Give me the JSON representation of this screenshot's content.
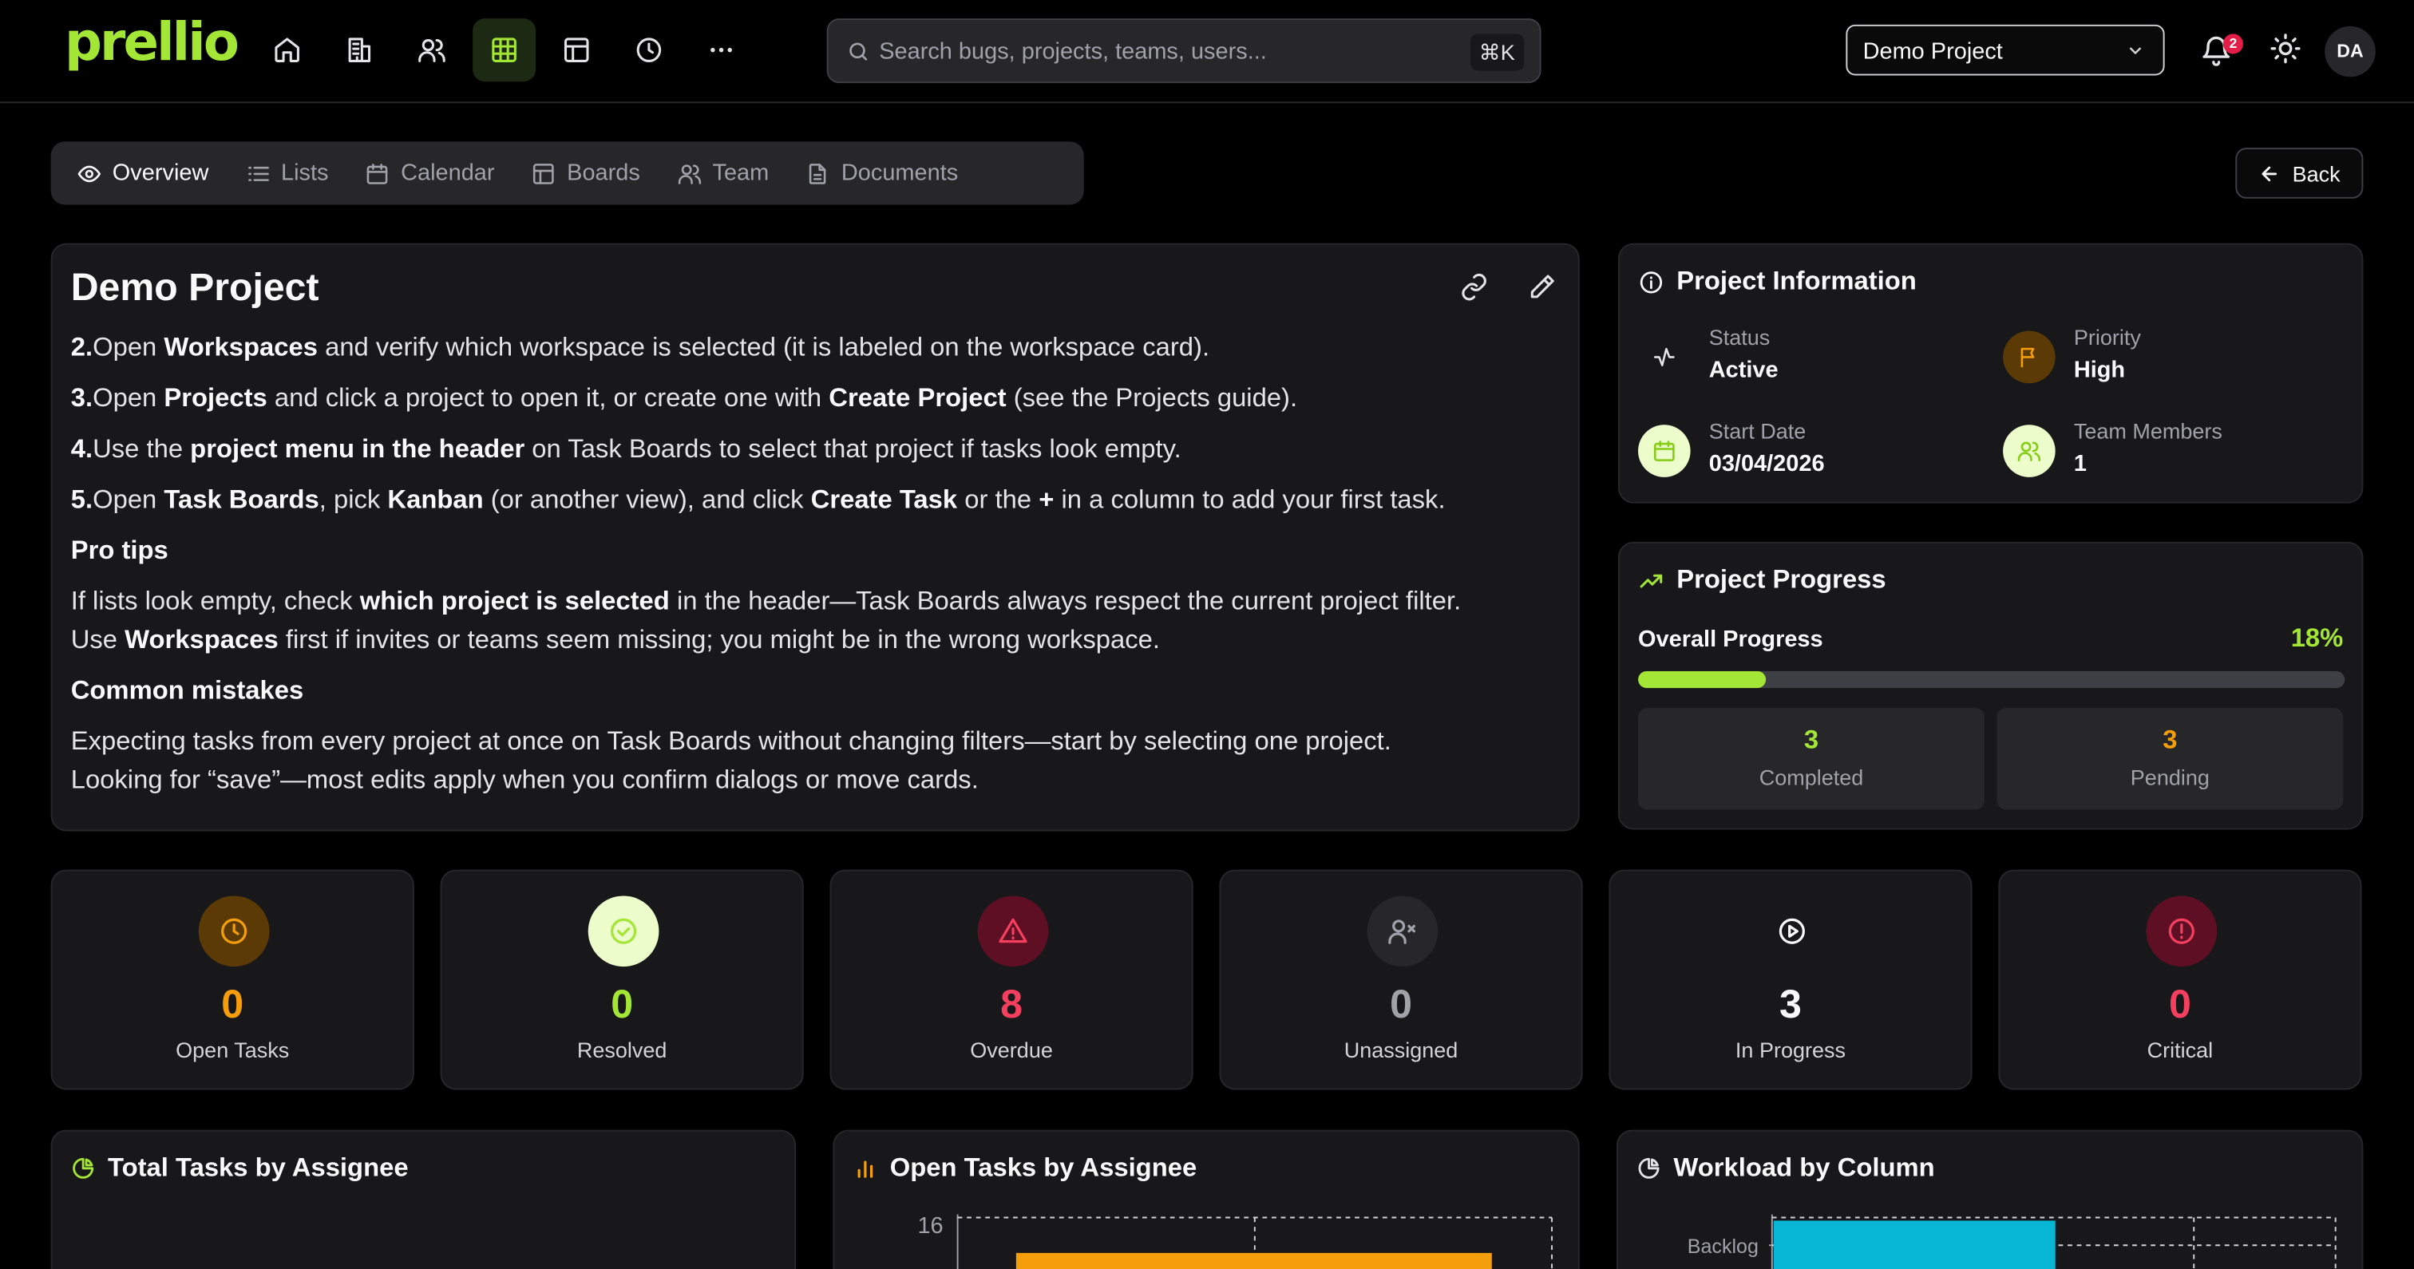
{
  "header": {
    "brand": "prellio",
    "nav": [
      {
        "icon": "home-icon"
      },
      {
        "icon": "building-icon"
      },
      {
        "icon": "users-icon"
      },
      {
        "icon": "grid-icon",
        "active": true
      },
      {
        "icon": "layout-icon"
      },
      {
        "icon": "clock-icon"
      },
      {
        "icon": "more-icon"
      }
    ],
    "search": {
      "placeholder": "Search bugs, projects, teams, users...",
      "shortcut": "⌘K"
    },
    "project_select": "Demo Project",
    "notification_count": "2",
    "avatar": "DA"
  },
  "tabs": [
    {
      "label": "Overview",
      "icon": "eye-icon",
      "active": true
    },
    {
      "label": "Lists",
      "icon": "list-icon"
    },
    {
      "label": "Calendar",
      "icon": "calendar-icon"
    },
    {
      "label": "Boards",
      "icon": "board-icon"
    },
    {
      "label": "Team",
      "icon": "users-icon"
    },
    {
      "label": "Documents",
      "icon": "document-icon"
    }
  ],
  "back_label": "Back",
  "main": {
    "title": "Demo Project",
    "steps": {
      "s2": {
        "num": "2.",
        "a": "Open ",
        "b": "Workspaces",
        "c": " and verify which workspace is selected (it is labeled on the workspace card)."
      },
      "s3": {
        "num": "3.",
        "a": "Open ",
        "b": "Projects",
        "c": " and click a project to open it, or create one with ",
        "d": "Create Project",
        "e": " (see the Projects guide)."
      },
      "s4": {
        "num": "4.",
        "a": "Use the ",
        "b": "project menu in the header",
        "c": " on Task Boards to select that project if tasks look empty."
      },
      "s5": {
        "num": "5.",
        "a": "Open ",
        "b": "Task Boards",
        "c": ", pick ",
        "d": "Kanban",
        "e": " (or another view), and click ",
        "f": "Create Task",
        "g": " or the ",
        "h": "+",
        "i": " in a column to add your first task."
      }
    },
    "pro_tips_heading": "Pro tips",
    "tip1": {
      "a": "If lists look empty, check ",
      "b": "which project is selected",
      "c": " in the header—Task Boards always respect the current project filter."
    },
    "tip2": {
      "a": "Use ",
      "b": "Workspaces",
      "c": " first if invites or teams seem missing; you might be in the wrong workspace."
    },
    "mistakes_heading": "Common mistakes",
    "mistake1": "Expecting tasks from every project at once on Task Boards without changing filters—start by selecting one project.",
    "mistake2": "Looking for “save”—most edits apply when you confirm dialogs or move cards."
  },
  "info": {
    "title": "Project Information",
    "status_label": "Status",
    "status_value": "Active",
    "priority_label": "Priority",
    "priority_value": "High",
    "start_label": "Start Date",
    "start_value": "03/04/2026",
    "members_label": "Team Members",
    "members_value": "1"
  },
  "progress": {
    "title": "Project Progress",
    "overall_label": "Overall Progress",
    "overall_value": "18%",
    "fraction": 0.18,
    "completed_value": "3",
    "completed_label": "Completed",
    "pending_value": "3",
    "pending_label": "Pending"
  },
  "stats": [
    {
      "value": "0",
      "label": "Open Tasks",
      "color": "#f59e0b",
      "bg": "#5c3a06",
      "icon": "clock-icon"
    },
    {
      "value": "0",
      "label": "Resolved",
      "color": "#a3e635",
      "bg": "#ecfccb",
      "icon": "check-circle-icon"
    },
    {
      "value": "8",
      "label": "Overdue",
      "color": "#f43f5e",
      "bg": "#5f0f24",
      "icon": "alert-triangle-icon"
    },
    {
      "value": "0",
      "label": "Unassigned",
      "color": "#a1a1aa",
      "bg": "#27272a",
      "icon": "user-x-icon"
    },
    {
      "value": "3",
      "label": "In Progress",
      "color": "#fafafa",
      "bg": "#18181b",
      "icon": "play-circle-icon"
    },
    {
      "value": "0",
      "label": "Critical",
      "color": "#f43f5e",
      "bg": "#5f0f24",
      "icon": "alert-circle-icon"
    }
  ],
  "charts": {
    "total_title": "Total Tasks by Assignee",
    "open_title": "Open Tasks by Assignee",
    "open_ytick": "16",
    "workload_title": "Workload by Column",
    "workload_row": "Backlog"
  },
  "colors": {
    "accent": "#a3e635",
    "warning": "#f59e0b",
    "danger": "#f43f5e",
    "bar_orange": "#f59e0b",
    "bar_cyan": "#06b6d4"
  }
}
